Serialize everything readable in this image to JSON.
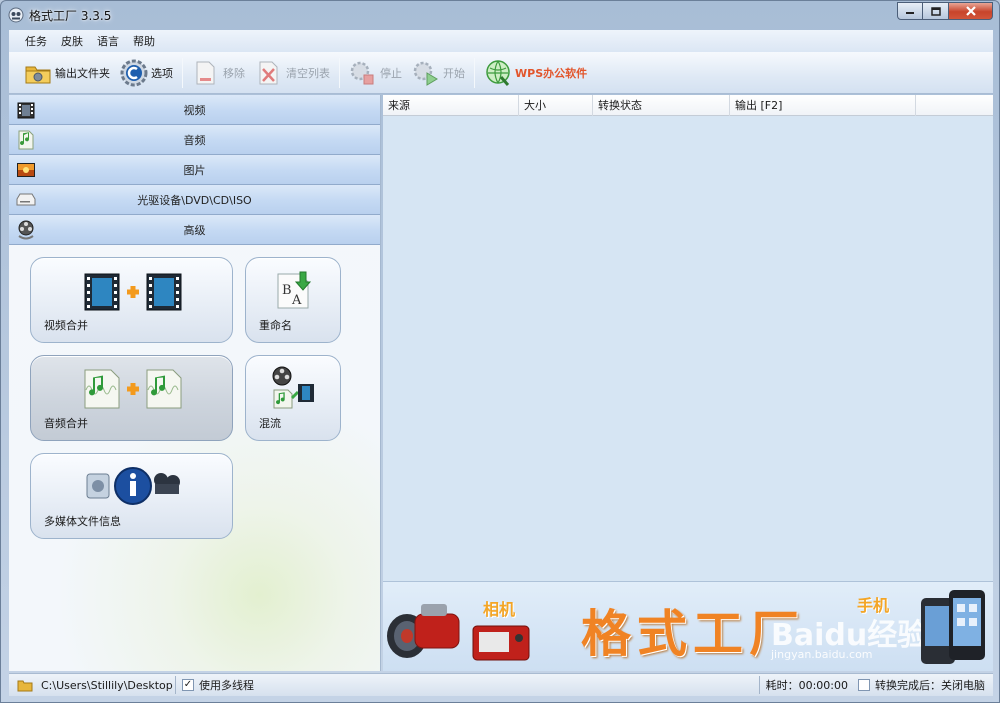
{
  "window": {
    "title": "格式工厂 3.3.5"
  },
  "menu": {
    "items": [
      {
        "label": "任务"
      },
      {
        "label": "皮肤"
      },
      {
        "label": "语言"
      },
      {
        "label": "帮助"
      }
    ]
  },
  "toolbar": {
    "output_folder": "输出文件夹",
    "options": "选项",
    "remove": "移除",
    "clear_list": "清空列表",
    "stop": "停止",
    "start": "开始",
    "wps": "WPS办公软件"
  },
  "categories": [
    {
      "label": "视频",
      "icon": "film-icon"
    },
    {
      "label": "音频",
      "icon": "music-note-icon"
    },
    {
      "label": "图片",
      "icon": "picture-icon"
    },
    {
      "label": "光驱设备\\DVD\\CD\\ISO",
      "icon": "optical-drive-icon"
    },
    {
      "label": "高级",
      "icon": "reel-icon"
    }
  ],
  "tools": {
    "video_merge": "视频合并",
    "rename": "重命名",
    "audio_merge": "音频合并",
    "mux": "混流",
    "media_info": "多媒体文件信息"
  },
  "table": {
    "columns": [
      "来源",
      "大小",
      "转换状态",
      "输出 [F2]"
    ]
  },
  "banner": {
    "title": "格式工厂",
    "camera_label": "相机",
    "phone_label": "手机",
    "watermark": "Baidu经验",
    "watermark_url": "jingyan.baidu.com"
  },
  "status": {
    "path": "C:\\Users\\Stillily\\Desktop",
    "multithread_label": "使用多线程",
    "multithread_checked": "✓",
    "elapsed": "耗时：00:00:00",
    "after_convert": "转换完成后：关闭电脑"
  },
  "colors": {
    "wps_accent": "#e2552b",
    "banner_title": "#f08324",
    "close_button": "#c8442b"
  }
}
